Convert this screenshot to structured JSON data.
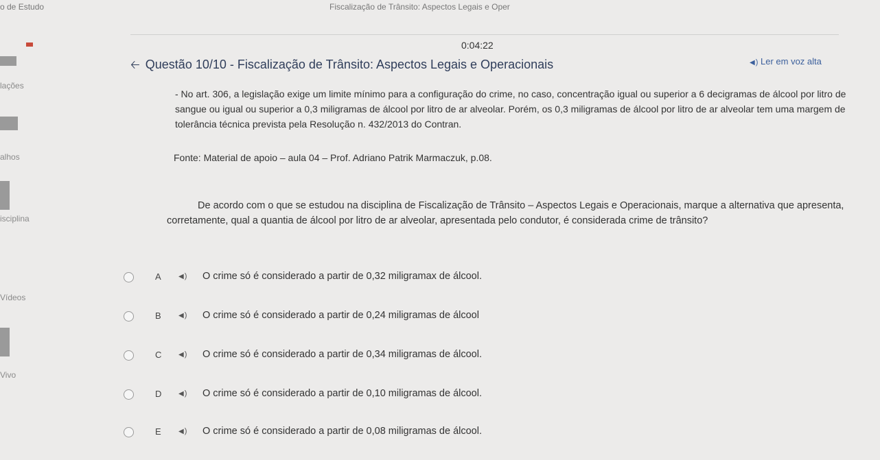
{
  "topbar": {
    "left_crumb": "o de Estudo",
    "page_title": "Fiscalização de Trânsito: Aspectos Legais e Oper"
  },
  "sidebar": {
    "items": [
      {
        "label": "lações"
      },
      {
        "label": "alhos"
      },
      {
        "label": "isciplina"
      },
      {
        "label": "Vídeos"
      },
      {
        "label": "Vivo"
      }
    ]
  },
  "timer": "0:04:22",
  "question": {
    "title": "Questão 10/10 - Fiscalização de Trânsito: Aspectos Legais e Operacionais",
    "tts_label": "Ler em voz alta",
    "paragraph": "- No art. 306, a legislação exige um limite mínimo para a configuração do crime, no caso, concentração igual ou superior a 6 decigramas de álcool por litro de sangue ou igual ou superior a 0,3 miligramas de álcool por litro de ar alveolar. Porém, os 0,3 miligramas de álcool por litro de ar alveolar tem uma margem de tolerância técnica prevista pela Resolução n. 432/2013 do Contran.",
    "source": "Fonte: Material de apoio – aula 04 – Prof. Adriano Patrik Marmaczuk, p.08.",
    "prompt": "De acordo com o que se estudou na disciplina de Fiscalização de Trânsito – Aspectos Legais e Operacionais, marque a alternativa que apresenta, corretamente, qual a quantia de álcool por litro de ar alveolar, apresentada pelo condutor, é considerada crime de trânsito?",
    "options": [
      {
        "letter": "A",
        "text": "O crime só é considerado a partir de 0,32 miligramax de álcool."
      },
      {
        "letter": "B",
        "text": "O crime só é considerado a partir de 0,24 miligramas de álcool"
      },
      {
        "letter": "C",
        "text": "O crime só é considerado a partir de 0,34 miligramas de álcool."
      },
      {
        "letter": "D",
        "text": "O crime só é considerado a partir de 0,10 miligramas de álcool."
      },
      {
        "letter": "E",
        "text": "O crime só é considerado a partir de 0,08 miligramas de álcool."
      }
    ]
  },
  "colors": {
    "title": "#2f3d5a",
    "link": "#3b5f9c",
    "background": "#ecebea"
  }
}
